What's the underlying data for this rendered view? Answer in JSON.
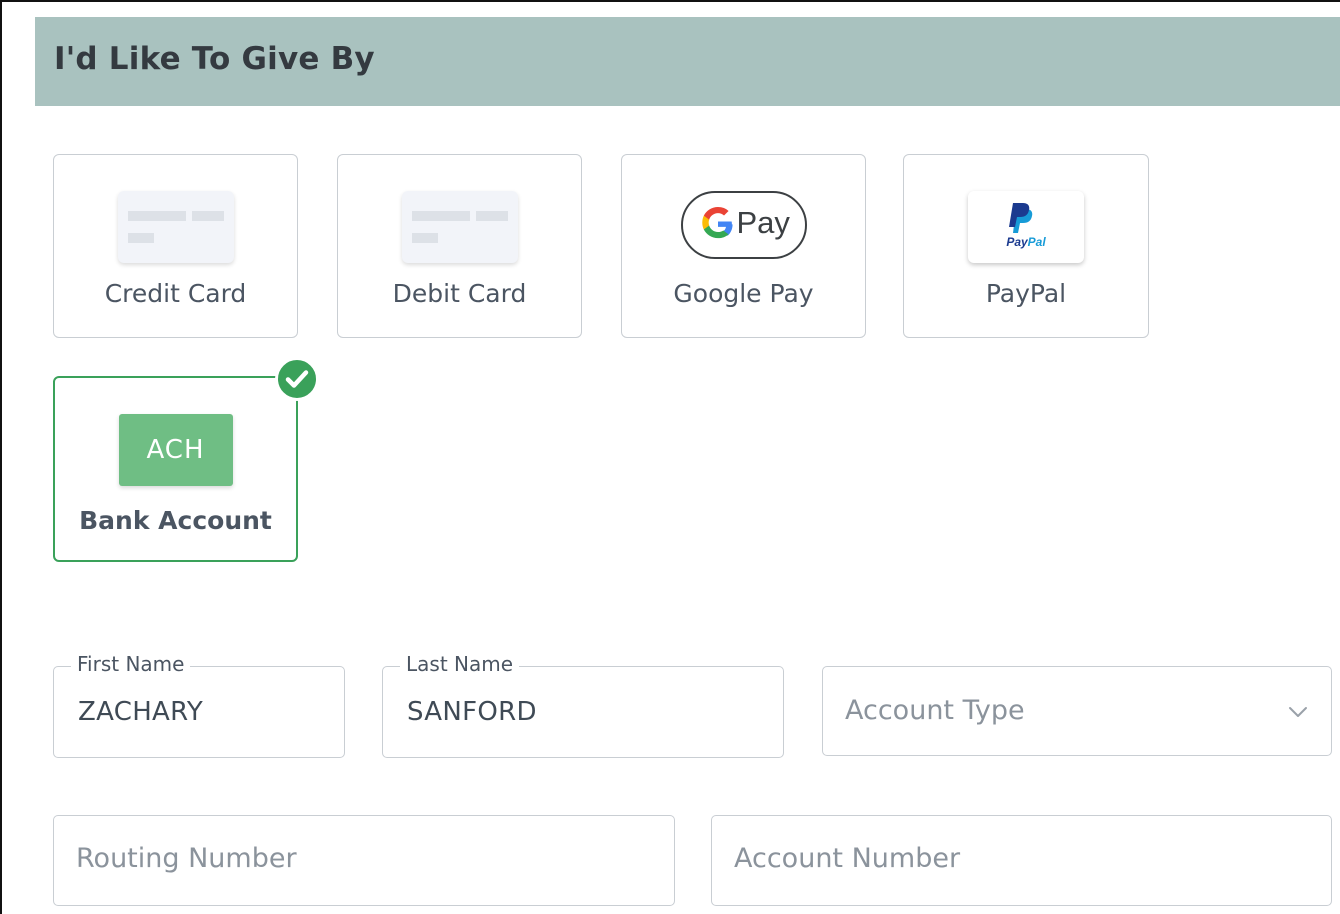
{
  "section": {
    "title": "I'd Like To Give By"
  },
  "payment_methods": [
    {
      "label": "Credit Card",
      "icon": "credit-card-icon",
      "selected": false
    },
    {
      "label": "Debit Card",
      "icon": "debit-card-icon",
      "selected": false
    },
    {
      "label": "Google Pay",
      "icon": "google-pay-icon",
      "icon_text": "Pay",
      "selected": false
    },
    {
      "label": "PayPal",
      "icon": "paypal-icon",
      "icon_text_a": "Pay",
      "icon_text_b": "Pal",
      "selected": false
    },
    {
      "label": "Bank Account",
      "icon": "ach-icon",
      "icon_text": "ACH",
      "selected": true
    }
  ],
  "form": {
    "first_name": {
      "label": "First Name",
      "value": "ZACHARY"
    },
    "last_name": {
      "label": "Last Name",
      "value": "SANFORD"
    },
    "account_type": {
      "placeholder": "Account Type"
    },
    "routing_number": {
      "placeholder": "Routing Number"
    },
    "account_number": {
      "placeholder": "Account Number"
    }
  },
  "colors": {
    "header_bg": "#a9c2bf",
    "selected_green": "#3aa15a",
    "ach_green": "#6fbe84",
    "border": "#c9ced3"
  }
}
